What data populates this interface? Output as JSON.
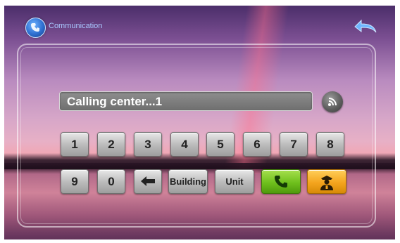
{
  "header": {
    "title": "Communication",
    "app_icon": "phone-bubble-icon",
    "back_icon": "back-arrow-icon"
  },
  "display": {
    "text": "Calling center...1",
    "signal_icon": "wifi-signal-icon"
  },
  "keypad": {
    "row1": [
      "1",
      "2",
      "3",
      "4",
      "5",
      "6",
      "7",
      "8"
    ],
    "row2": [
      "9",
      "0"
    ],
    "backspace_icon": "backspace-arrow-icon",
    "building_label": "Building",
    "unit_label": "Unit",
    "call_icon": "phone-call-icon",
    "guard_icon": "security-guard-icon"
  },
  "colors": {
    "call_button": "#6fc01d",
    "guard_button": "#f4a51e",
    "title_text": "#a9c8ff"
  }
}
